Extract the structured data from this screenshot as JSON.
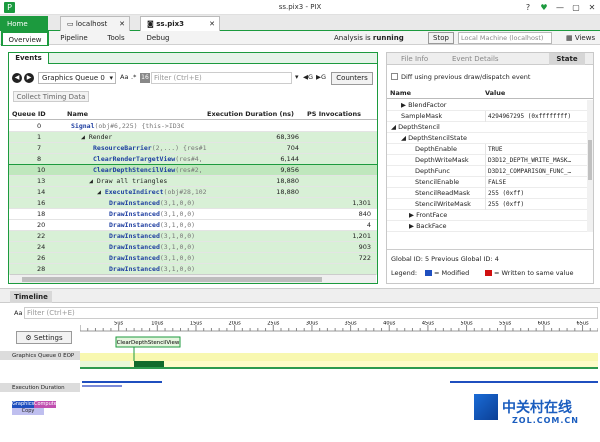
{
  "window": {
    "title": "ss.pix3 - PIX",
    "logo": "P",
    "help": "?",
    "min": "—",
    "max": "▢",
    "close": "✕",
    "fav": "♥"
  },
  "tabs": [
    {
      "label": "Home"
    },
    {
      "label": "localhost"
    },
    {
      "label": "ss.pix3"
    }
  ],
  "menu": [
    "Overview",
    "Pipeline",
    "Tools",
    "Debug"
  ],
  "analysis": {
    "prefix": "Analysis is",
    "state": "running",
    "stop": "Stop",
    "target": "Local Machine (localhost)",
    "views": "Views"
  },
  "events": {
    "tab": "Events",
    "queue": "Graphics Queue 0",
    "aa": "Aa",
    "star": ".*",
    "filter_placeholder": "Filter (Ctrl+E)",
    "counters": "Counters",
    "collect": "Collect Timing Data",
    "g1": "G",
    "g2": "G",
    "columns": [
      "Queue ID",
      "Name",
      "Execution Duration (ns)",
      "PS Invocations"
    ],
    "rows": [
      {
        "id": "0",
        "name": "Signal",
        "args": "(obj#6,225)",
        "extra": "{this->ID3€",
        "dur": "",
        "ps": "",
        "indent": 4,
        "arrow": "",
        "style": "",
        "api": true
      },
      {
        "id": "1",
        "name": "Render",
        "args": "",
        "extra": "",
        "dur": "68,396",
        "ps": "",
        "indent": 14,
        "arrow": "◢",
        "style": "green",
        "api": false
      },
      {
        "id": "7",
        "name": "ResourceBarrier",
        "args": "(2,...)",
        "extra": "{res#1",
        "dur": "704",
        "ps": "",
        "indent": 26,
        "arrow": "",
        "style": "green",
        "api": true
      },
      {
        "id": "8",
        "name": "ClearRenderTargetView",
        "args": "(res#4,",
        "extra": "",
        "dur": "6,144",
        "ps": "",
        "indent": 26,
        "arrow": "",
        "style": "green",
        "api": true
      },
      {
        "id": "10",
        "name": "ClearDepthStencilView",
        "args": "(res#2,",
        "extra": "",
        "dur": "9,856",
        "ps": "",
        "indent": 26,
        "arrow": "",
        "style": "sel",
        "api": true
      },
      {
        "id": "13",
        "name": "Draw all triangles",
        "args": "",
        "extra": "",
        "dur": "18,880",
        "ps": "",
        "indent": 22,
        "arrow": "◢",
        "style": "green",
        "api": false
      },
      {
        "id": "14",
        "name": "ExecuteIndirect",
        "args": "(obj#28,102",
        "extra": "",
        "dur": "18,880",
        "ps": "",
        "indent": 30,
        "arrow": "◢",
        "style": "green",
        "api": true
      },
      {
        "id": "16",
        "name": "DrawInstanced",
        "args": "(3,1,0,0)",
        "extra": "",
        "dur": "",
        "ps": "1,301",
        "indent": 42,
        "arrow": "",
        "style": "green",
        "api": true
      },
      {
        "id": "18",
        "name": "DrawInstanced",
        "args": "(3,1,0,0)",
        "extra": "",
        "dur": "",
        "ps": "840",
        "indent": 42,
        "arrow": "",
        "style": "",
        "api": true
      },
      {
        "id": "20",
        "name": "DrawInstanced",
        "args": "(3,1,0,0)",
        "extra": "",
        "dur": "",
        "ps": "4",
        "indent": 42,
        "arrow": "",
        "style": "",
        "api": true
      },
      {
        "id": "22",
        "name": "DrawInstanced",
        "args": "(3,1,0,0)",
        "extra": "",
        "dur": "",
        "ps": "1,201",
        "indent": 42,
        "arrow": "",
        "style": "green",
        "api": true
      },
      {
        "id": "24",
        "name": "DrawInstanced",
        "args": "(3,1,0,0)",
        "extra": "",
        "dur": "",
        "ps": "903",
        "indent": 42,
        "arrow": "",
        "style": "green",
        "api": true
      },
      {
        "id": "26",
        "name": "DrawInstanced",
        "args": "(3,1,0,0)",
        "extra": "",
        "dur": "",
        "ps": "722",
        "indent": 42,
        "arrow": "",
        "style": "green",
        "api": true
      },
      {
        "id": "28",
        "name": "DrawInstanced",
        "args": "(3,1,0,0)",
        "extra": "",
        "dur": "",
        "ps": "",
        "indent": 42,
        "arrow": "",
        "style": "green",
        "api": true
      }
    ]
  },
  "state": {
    "tabs": [
      "File Info",
      "Event Details",
      "State"
    ],
    "diff": "Diff using previous draw/dispatch event",
    "columns": [
      "Name",
      "Value"
    ],
    "rows": [
      {
        "name": "BlendFactor",
        "value": "",
        "indent": 14,
        "arrow": "▶"
      },
      {
        "name": "SampleMask",
        "value": "4294967295 (0xffffffff)",
        "indent": 14,
        "arrow": ""
      },
      {
        "name": "DepthStencil",
        "value": "",
        "indent": 4,
        "arrow": "◢"
      },
      {
        "name": "DepthStencilState",
        "value": "",
        "indent": 14,
        "arrow": "◢"
      },
      {
        "name": "DepthEnable",
        "value": "TRUE",
        "indent": 28,
        "arrow": ""
      },
      {
        "name": "DepthWriteMask",
        "value": "D3D12_DEPTH_WRITE_MASK…",
        "indent": 28,
        "arrow": ""
      },
      {
        "name": "DepthFunc",
        "value": "D3D12_COMPARISON_FUNC_…",
        "indent": 28,
        "arrow": ""
      },
      {
        "name": "StencilEnable",
        "value": "FALSE",
        "indent": 28,
        "arrow": ""
      },
      {
        "name": "StencilReadMask",
        "value": "255 (0xff)",
        "indent": 28,
        "arrow": ""
      },
      {
        "name": "StencilWriteMask",
        "value": "255 (0xff)",
        "indent": 28,
        "arrow": ""
      },
      {
        "name": "FrontFace",
        "value": "",
        "indent": 22,
        "arrow": "▶"
      },
      {
        "name": "BackFace",
        "value": "",
        "indent": 22,
        "arrow": "▶"
      }
    ],
    "ids": "Global ID: 5  Previous Global ID: 4",
    "legend": "Legend:",
    "modified": "= Modified",
    "written": "= Written to same value"
  },
  "timeline": {
    "tab": "Timeline",
    "aa": "Aa",
    "filter_placeholder": "Filter (Ctrl+E)",
    "settings": "Settings",
    "ticks": [
      "5us",
      "10us",
      "15us",
      "20us",
      "25us",
      "30us",
      "35us",
      "40us",
      "45us",
      "50us",
      "55us",
      "60us",
      "65us"
    ],
    "tick_values": [
      5,
      10,
      15,
      20,
      25,
      30,
      35,
      40,
      45,
      50,
      55,
      60,
      65
    ],
    "range_max": 67,
    "lane1": "Graphics Queue 0 EOP",
    "lane2": "Execution Duration",
    "tooltip": "ClearDepthStencilView",
    "legend": [
      "Graphics",
      "Compute",
      "Copy"
    ]
  },
  "watermark": {
    "text": "中关村在线",
    "sub": "ZOL.COM.CN"
  },
  "colors": {
    "accent": "#1c9a3e",
    "blue": "#1f4fbf",
    "red": "#d01010"
  }
}
